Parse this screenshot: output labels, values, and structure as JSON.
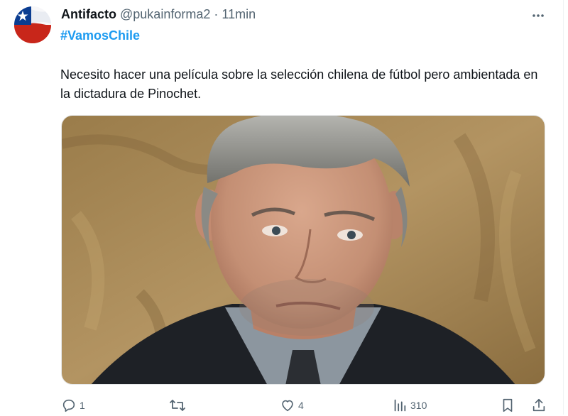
{
  "tweet": {
    "author": {
      "display_name": "Antifacto",
      "handle": "@pukainforma2",
      "separator": "·",
      "time": "11min",
      "avatar_icon": "chile-flag-avatar"
    },
    "hashtag": "#VamosChile",
    "text": "Necesito hacer una película sobre la selección chilena de fútbol pero ambientada en la dictadura de Pinochet.",
    "media": {
      "description_icon": "portrait-photo"
    },
    "more_icon": "more-dots-icon"
  },
  "actions": {
    "reply": {
      "icon": "reply-icon",
      "count": "1"
    },
    "retweet": {
      "icon": "retweet-icon",
      "count": ""
    },
    "like": {
      "icon": "heart-icon",
      "count": "4"
    },
    "views": {
      "icon": "views-icon",
      "count": "310"
    },
    "bookmark": {
      "icon": "bookmark-icon"
    },
    "share": {
      "icon": "share-icon"
    }
  },
  "colors": {
    "link": "#1d9bf0",
    "muted": "#536471",
    "text": "#0f1419",
    "backdrop_gold": "#a88a55"
  }
}
